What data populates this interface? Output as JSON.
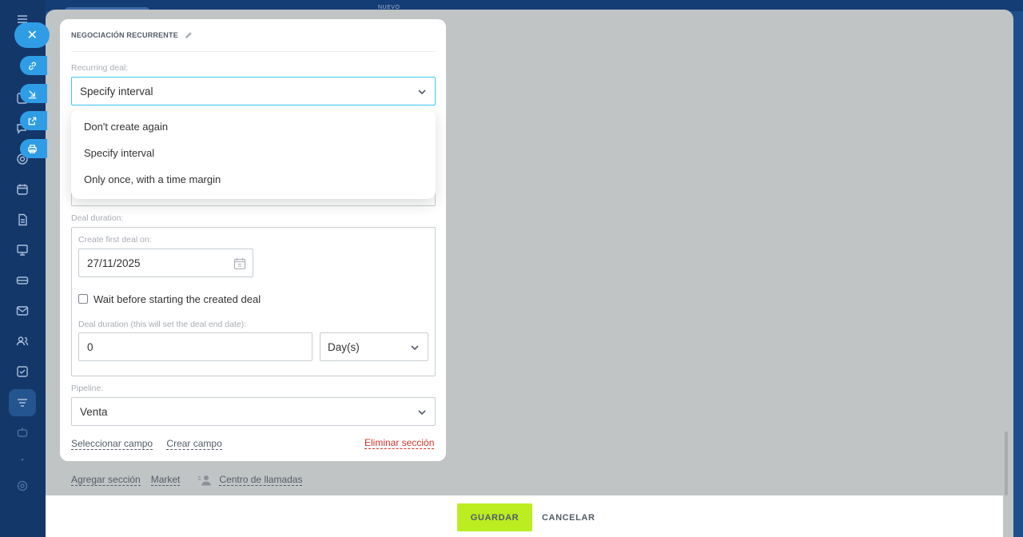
{
  "background": {
    "top_label": "NUEVO"
  },
  "card": {
    "title": "NEGOCIACIÓN RECURRENTE",
    "recurring_deal": {
      "label": "Recurring deal:",
      "value": "Specify interval",
      "options": [
        "Don't create again",
        "Specify interval",
        "Only once, with a time margin"
      ]
    },
    "deal_duration": {
      "label": "Deal duration:",
      "create_first_label": "Create first deal on:",
      "create_first_value": "27/11/2025",
      "wait_checkbox_label": "Wait before starting the created deal",
      "wait_checked": false,
      "duration_label": "Deal duration (this will set the deal end date):",
      "duration_value": "0",
      "unit_value": "Day(s)"
    },
    "pipeline": {
      "label": "Pipeline:",
      "value": "Venta"
    },
    "links": {
      "select_field": "Seleccionar campo",
      "create_field": "Crear campo",
      "delete_section": "Eliminar sección"
    }
  },
  "below_links": {
    "add_section": "Agregar sección",
    "market": "Market",
    "call_center": "Centro de llamadas"
  },
  "footer": {
    "save_label": "GUARDAR",
    "cancel_label": "CANCELAR"
  },
  "colors": {
    "accent": "#2f9de6",
    "save_button": "#bbed21",
    "danger_link": "#d1342b",
    "focus_border": "#3bc8f5"
  },
  "icons": {
    "side_buttons": [
      "link-icon",
      "download-icon",
      "external-link-icon",
      "print-icon"
    ],
    "left_rail": [
      "menu-icon",
      "chat-icon",
      "feed-icon",
      "target-icon",
      "calendar-icon",
      "document-icon",
      "presentation-icon",
      "card-icon",
      "mail-icon",
      "users-icon",
      "task-icon",
      "filter-icon",
      "robot-icon",
      "dots-icon",
      "settings-icon"
    ]
  }
}
